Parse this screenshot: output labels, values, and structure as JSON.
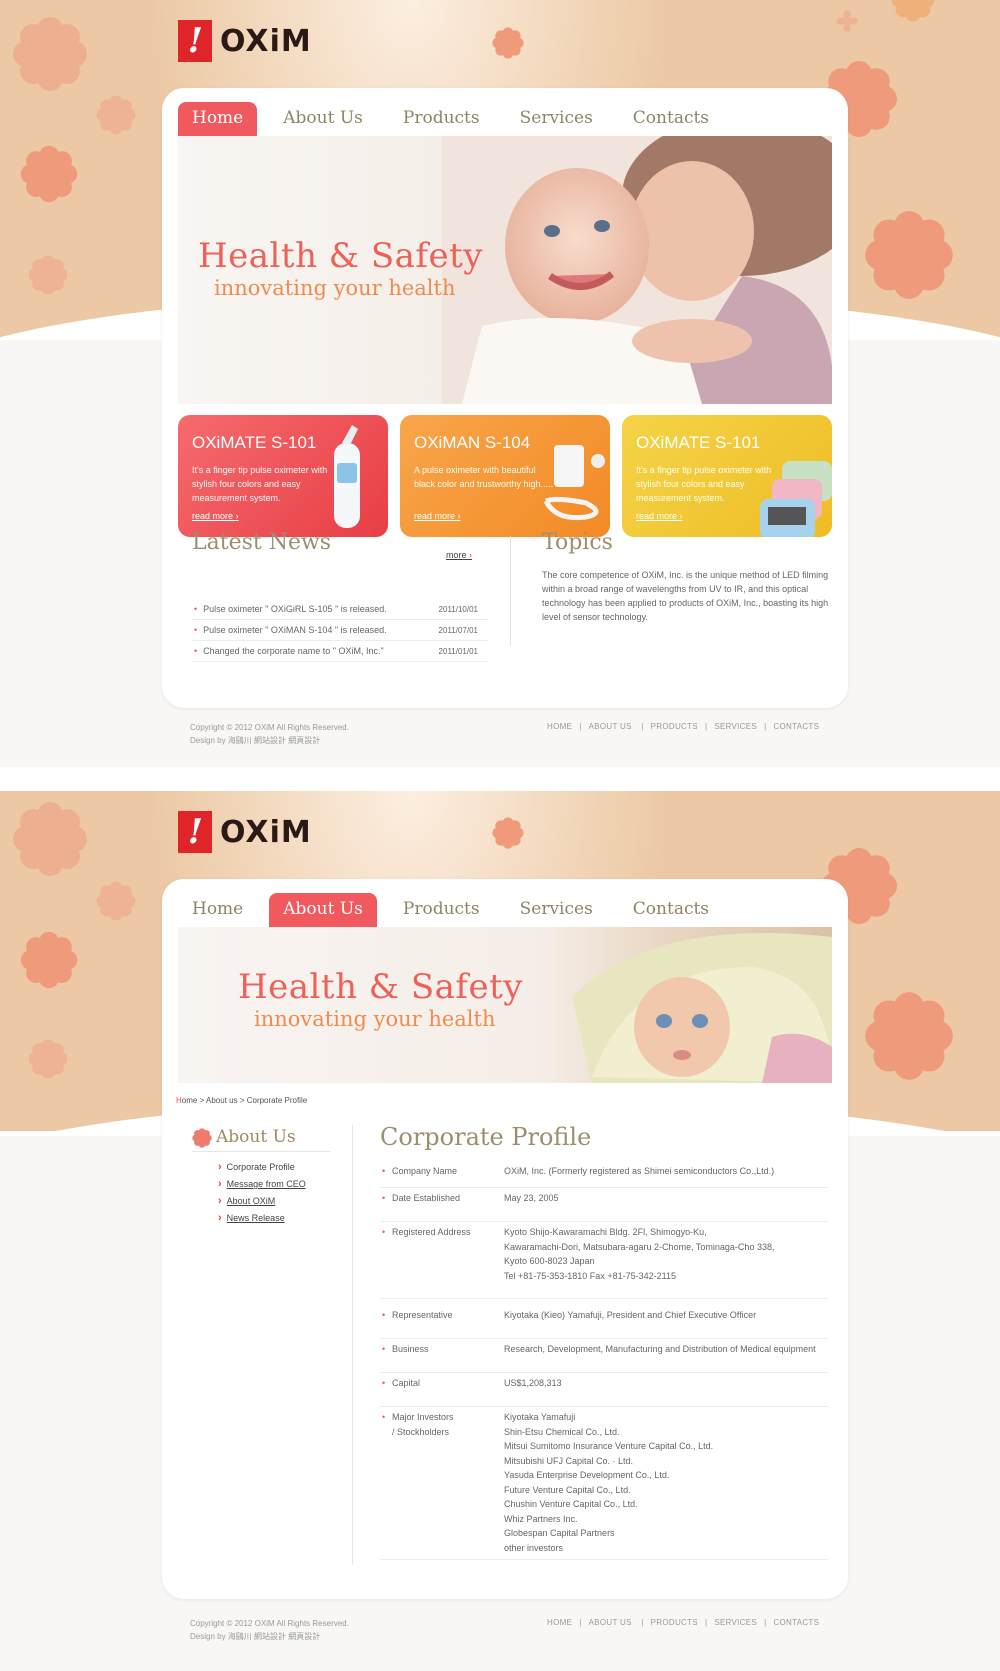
{
  "brand": {
    "logo_mark": "!",
    "logo_text": "OXiM"
  },
  "colors": {
    "accent": "#f0595d",
    "header_bg": "#ecc9a4",
    "flower": "#f0a58a",
    "title": "#9a9070"
  },
  "page1": {
    "nav": [
      "Home",
      "About Us",
      "Products",
      "Services",
      "Contacts"
    ],
    "active_nav": "Home",
    "hero": {
      "title": "Health & Safety",
      "subtitle": "innovating your health"
    },
    "products": [
      {
        "name": "OXiMATE S-101",
        "desc": "It's a finger tip pulse oximeter with stylish four colors and easy measurement system.",
        "link": "read more",
        "color": "#ef4d52"
      },
      {
        "name": "OXiMAN S-104",
        "desc": "A pulse oximeter with beautiful black color and trustworthy high.....",
        "link": "read more",
        "color": "#f59233"
      },
      {
        "name": "OXiMATE S-101",
        "desc": "It's a finger tip pulse oximeter with stylish four colors and easy measurement system.",
        "link": "read more",
        "color": "#f2c531"
      }
    ],
    "news": {
      "title": "Latest News",
      "more": "more",
      "items": [
        {
          "text": "Pulse oximeter \" OXiGiRL S-105 \" is released.",
          "date": "2011/10/01"
        },
        {
          "text": "Pulse oximeter \" OXiMAN S-104 \" is released.",
          "date": "2011/07/01"
        },
        {
          "text": "Changed the corporate name to \" OXiM, Inc.\"",
          "date": "2011/01/01"
        }
      ]
    },
    "topics": {
      "title": "Topics",
      "text": "The core competence of OXiM, Inc. is the unique method of LED filming within a broad range of wavelengths from UV to IR, and this optical technology has been applied to products of OXiM, Inc., boasting its high level of sensor technology."
    }
  },
  "footer": {
    "copyright": "Copyright © 2012 OXiM All Rights Reserved.",
    "design": "Design by 海鷗川 網站設計 網頁設計",
    "links": [
      "HOME",
      "ABOUT US",
      "PRODUCTS",
      "SERVICES",
      "CONTACTS"
    ]
  },
  "page2": {
    "nav": [
      "Home",
      "About Us",
      "Products",
      "Services",
      "Contacts"
    ],
    "active_nav": "About Us",
    "hero": {
      "title": "Health & Safety",
      "subtitle": "innovating your health"
    },
    "breadcrumb": {
      "first_letter": "H",
      "rest": "ome > About us > Corporate Profile"
    },
    "sidebar": {
      "title": "About Us",
      "links": [
        "Corporate Profile",
        "Message from CEO",
        "About OXiM",
        "News Release"
      ]
    },
    "profile": {
      "title": "Corporate Profile",
      "rows": [
        {
          "k": "Company Name",
          "v": "OXiM, Inc. (Formerly registered as Shimei semiconductors Co.,Ltd.)"
        },
        {
          "k": "Date Established",
          "v": "May 23, 2005"
        },
        {
          "k": "Registered Address",
          "v": "Kyoto Shijo-Kawaramachi Bldg. 2Fl, Shimogyo-Ku,\nKawaramachi-Dori, Matsubara-agaru 2-Chome, Tominaga-Cho 338,\nKyoto 600-8023 Japan\nTel +81-75-353-1810 Fax +81-75-342-2115"
        },
        {
          "k": "Representative",
          "v": "Kiyotaka (Kieo) Yamafuji, President and Chief Executive Officer"
        },
        {
          "k": "Business",
          "v": "Research, Development, Manufacturing and Distribution of Medical equipment"
        },
        {
          "k": "Capital",
          "v": "US$1,208,313"
        },
        {
          "k": "Major Investors\n/ Stockholders",
          "v": "Kiyotaka Yamafuji\nShin-Etsu Chemical Co., Ltd.\nMitsui Sumitomo Insurance Venture Capital Co., Ltd.\nMitsubishi UFJ Capital Co. · Ltd.\nYasuda Enterprise Development Co., Ltd.\nFuture Venture Capital Co., Ltd.\nChushin Venture Capital Co., Ltd.\nWhiz Partners Inc.\nGlobespan Capital Partners\nother investors"
        }
      ]
    }
  }
}
